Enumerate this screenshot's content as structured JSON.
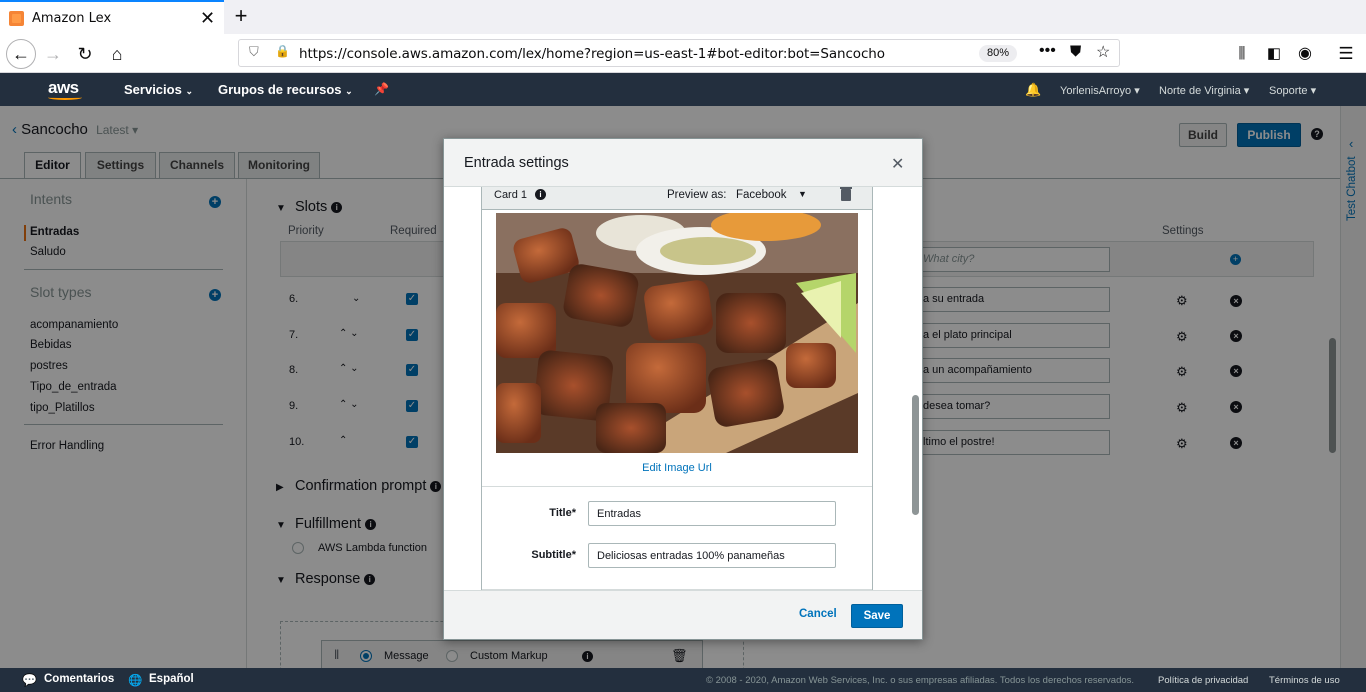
{
  "browser": {
    "tab_title": "Amazon Lex",
    "url": "https://console.aws.amazon.com/lex/home?region=us-east-1#bot-editor:bot=Sancocho",
    "zoom": "80%"
  },
  "aws_header": {
    "logo": "aws",
    "services": "Servicios",
    "resource_groups": "Grupos de recursos",
    "user": "YorlenisArroyo",
    "region": "Norte de Virginia",
    "support": "Soporte"
  },
  "bot": {
    "name": "Sancocho",
    "version": "Latest",
    "build": "Build",
    "publish": "Publish"
  },
  "tabs": [
    "Editor",
    "Settings",
    "Channels",
    "Monitoring"
  ],
  "sidebar": {
    "intents_title": "Intents",
    "intents": [
      "Entradas",
      "Saludo"
    ],
    "slot_types_title": "Slot types",
    "slot_types": [
      "acompanamiento",
      "Bebidas",
      "postres",
      "Tipo_de_entrada",
      "tipo_Platillos"
    ],
    "error_handling": "Error Handling"
  },
  "main": {
    "slots_title": "Slots",
    "col_priority": "Priority",
    "col_required": "Required",
    "col_settings": "Settings",
    "prompt_placeholder": "What city?",
    "rows": [
      {
        "num": "6.",
        "prompt": "a su entrada"
      },
      {
        "num": "7.",
        "prompt": "a el plato principal"
      },
      {
        "num": "8.",
        "prompt": "a un acompañamiento"
      },
      {
        "num": "9.",
        "prompt": "desea tomar?"
      },
      {
        "num": "10.",
        "prompt": "ltimo el postre!"
      }
    ],
    "confirmation_prompt": "Confirmation prompt",
    "fulfillment": "Fulfillment",
    "lambda": "AWS Lambda function",
    "response": "Response",
    "message": "Message",
    "custom_markup": "Custom Markup"
  },
  "side_tab": "Test Chatbot",
  "modal": {
    "title": "Entrada settings",
    "card_label": "Card 1",
    "preview_label": "Preview as:",
    "preview_value": "Facebook",
    "edit_image": "Edit Image Url",
    "title_label": "Title*",
    "title_value": "Entradas",
    "subtitle_label": "Subtitle*",
    "subtitle_value": "Deliciosas entradas 100% panameñas",
    "cancel": "Cancel",
    "save": "Save"
  },
  "footer": {
    "feedback": "Comentarios",
    "language": "Español",
    "copyright": "© 2008 - 2020, Amazon Web Services, Inc. o sus empresas afiliadas. Todos los derechos reservados.",
    "privacy": "Política de privacidad",
    "terms": "Términos de uso"
  }
}
